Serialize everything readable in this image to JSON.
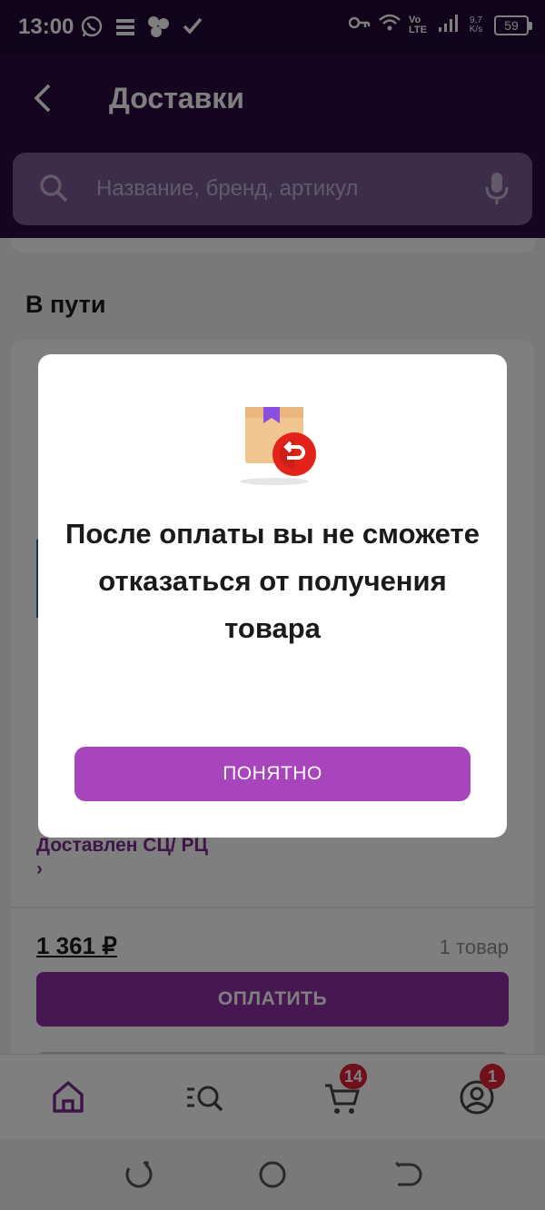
{
  "status_bar": {
    "time": "13:00",
    "volte": "Vo LTE",
    "net_rate": "9,7 K/s",
    "battery": "59"
  },
  "header": {
    "title": "Доставки",
    "search_placeholder": "Название, бренд, артикул"
  },
  "content": {
    "section_title": "В пути",
    "order": {
      "status": "Доставлен СЦ/ РЦ ›",
      "price": "1 361 ₽",
      "item_count": "1 товар",
      "pay_button": "ОПЛАТИТЬ"
    }
  },
  "bottom_nav": {
    "cart_badge": "14",
    "profile_badge": "1"
  },
  "dialog": {
    "message": "После оплаты вы не сможете отказаться от получения товара",
    "button": "ПОНЯТНО"
  },
  "colors": {
    "header_bg": "#2b0a3d",
    "accent_purple": "#a845bd",
    "badge_red": "#e0213a"
  }
}
